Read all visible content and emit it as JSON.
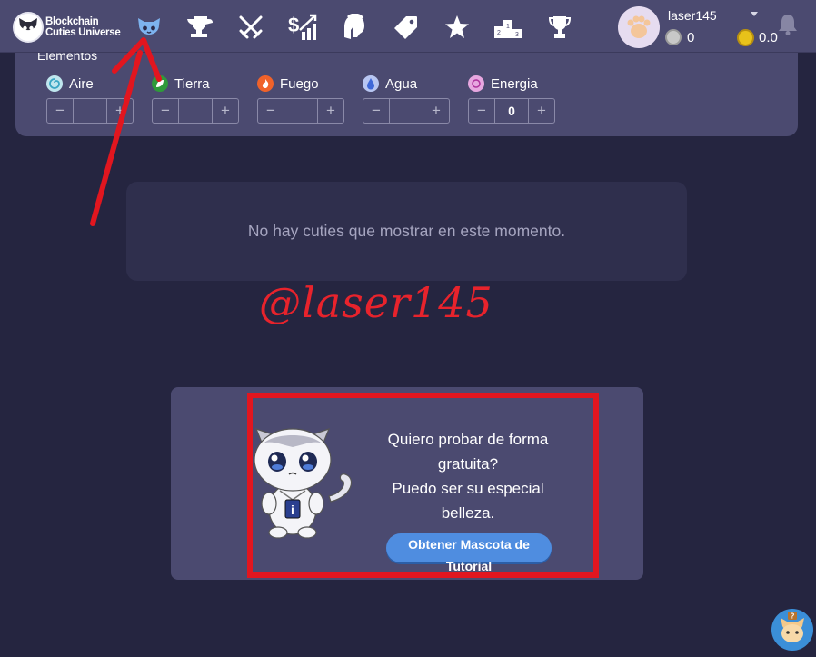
{
  "header": {
    "logo_line1": "Blockchain",
    "logo_line2": "Cuties Universe",
    "nav_icons": [
      "cat-icon",
      "anvil-icon",
      "crossed-swords-icon",
      "dollar-chart-icon",
      "spartan-helmet-icon",
      "tag-icon",
      "star-icon",
      "podium-icon",
      "trophy-icon"
    ],
    "username": "laser145",
    "silver_balance": "0",
    "gold_balance": "0.0"
  },
  "filters": {
    "title": "Elementos",
    "elements": [
      {
        "name": "Aire",
        "icon": "wind-swirl-icon",
        "value": ""
      },
      {
        "name": "Tierra",
        "icon": "leaf-icon",
        "value": ""
      },
      {
        "name": "Fuego",
        "icon": "fire-icon",
        "value": ""
      },
      {
        "name": "Agua",
        "icon": "water-drop-icon",
        "value": ""
      },
      {
        "name": "Energia",
        "icon": "energy-swirl-icon",
        "value": "0"
      }
    ],
    "minus": "−",
    "plus": "+"
  },
  "empty_state": {
    "message": "No hay cuties que mostrar en este momento."
  },
  "watermark": "@laser145",
  "tutorial": {
    "line1": "Quiero probar de forma gratuita?",
    "line2": "Puedo ser su especial belleza.",
    "button": "Obtener Mascota de Tutorial"
  },
  "colors": {
    "background": "#252540",
    "panel": "#4b4a70",
    "accent_button": "#4f8de0",
    "annotation_red": "#e1161f"
  }
}
